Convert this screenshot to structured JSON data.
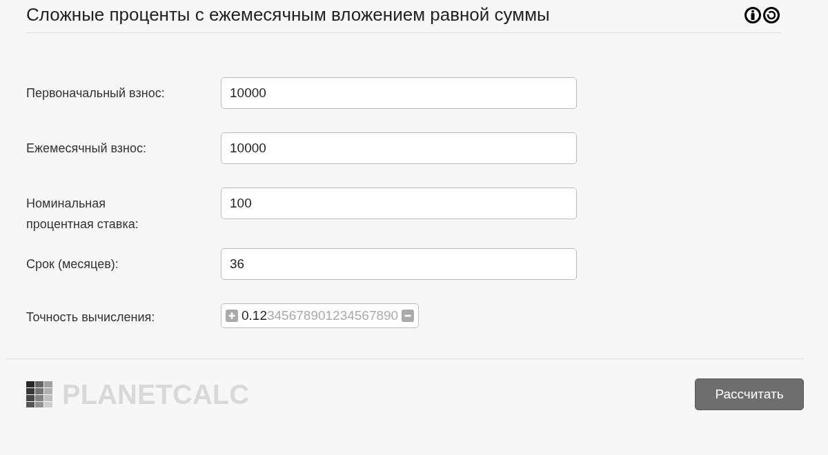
{
  "title": "Сложные проценты с ежемесячным вложением равной суммы",
  "fields": [
    {
      "label": "Первоначальный взнос:",
      "value": "10000"
    },
    {
      "label": "Ежемесячный взнос:",
      "value": "10000"
    },
    {
      "label": "Номинальная процентная ставка:",
      "value": "100"
    },
    {
      "label": "Срок (месяцев):",
      "value": "36"
    }
  ],
  "precision": {
    "label": "Точность вычисления:",
    "shown": "0.12",
    "remaining": "345678901234567890"
  },
  "logo": "PLANETCALC",
  "button": "Рассчитать"
}
